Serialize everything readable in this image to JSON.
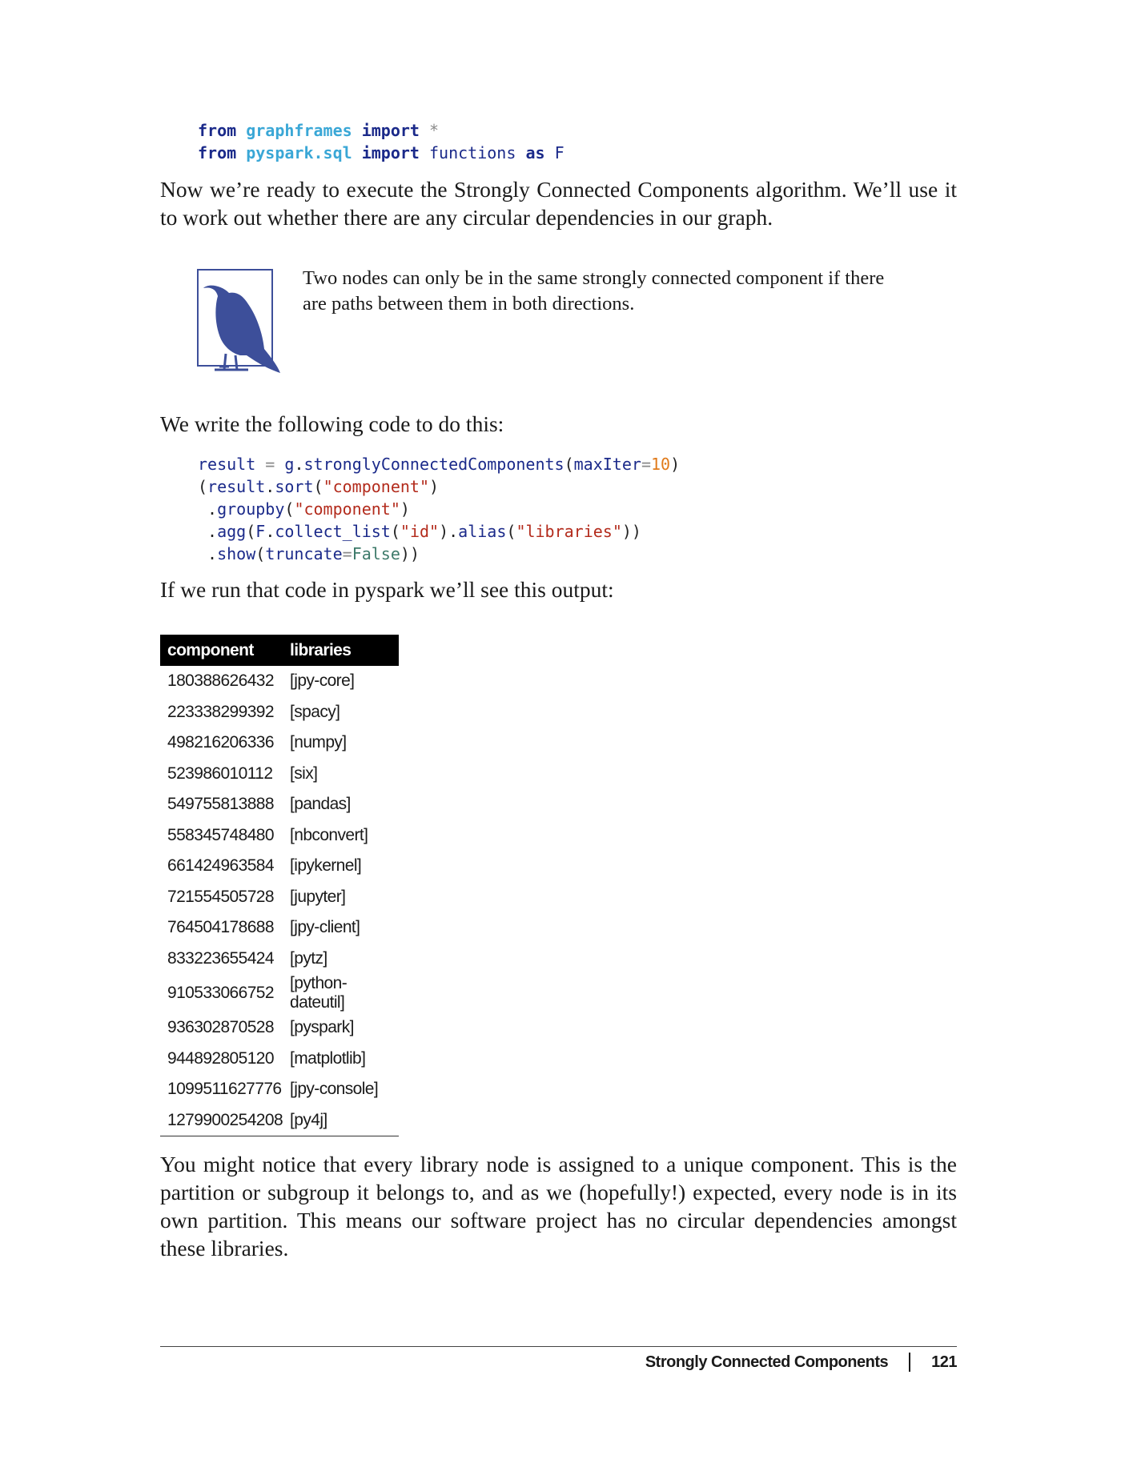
{
  "code_import": {
    "line1": {
      "kw1": "from",
      "mod": "graphframes",
      "kw2": "import",
      "rest": "*"
    },
    "line2": {
      "kw1": "from",
      "mod": "pyspark.sql",
      "kw2": "import",
      "name": "functions",
      "kw3": "as",
      "alias": "F"
    }
  },
  "para1": "Now we’re ready to execute the Strongly Connected Components algorithm. We’ll use it to work out whether there are any circular dependencies in our graph.",
  "note": {
    "icon": "bird-icon",
    "text": "Two nodes can only be in the same strongly connected component if there are paths between them in both directions."
  },
  "para2": "We write the following code to do this:",
  "code_scc": {
    "l1": {
      "var": "result",
      "eq": "=",
      "obj": "g",
      "method": "stronglyConnectedComponents",
      "param": "maxIter",
      "val": "10"
    },
    "l2": {
      "obj": "result",
      "method": "sort",
      "arg": "\"component\""
    },
    "l3": {
      "method": "groupby",
      "arg": "\"component\""
    },
    "l4": {
      "method": "agg",
      "obj": "F",
      "fn": "collect_list",
      "arg": "\"id\"",
      "fn2": "alias",
      "arg2": "\"libraries\""
    },
    "l5": {
      "method": "show",
      "param": "truncate",
      "val": "False"
    }
  },
  "para3": "If we run that code in pyspark we’ll see this output:",
  "table": {
    "headers": [
      "component",
      "libraries"
    ],
    "rows": [
      [
        "180388626432",
        "[jpy-core]"
      ],
      [
        "223338299392",
        "[spacy]"
      ],
      [
        "498216206336",
        "[numpy]"
      ],
      [
        "523986010112",
        "[six]"
      ],
      [
        "549755813888",
        "[pandas]"
      ],
      [
        "558345748480",
        "[nbconvert]"
      ],
      [
        "661424963584",
        "[ipykernel]"
      ],
      [
        "721554505728",
        "[jupyter]"
      ],
      [
        "764504178688",
        "[jpy-client]"
      ],
      [
        "833223655424",
        "[pytz]"
      ],
      [
        "910533066752",
        "[python-dateutil]"
      ],
      [
        "936302870528",
        "[pyspark]"
      ],
      [
        "944892805120",
        "[matplotlib]"
      ],
      [
        "1099511627776",
        "[jpy-console]"
      ],
      [
        "1279900254208",
        "[py4j]"
      ]
    ]
  },
  "para4": "You might notice that every library node is assigned to a unique component. This is the partition or subgroup it belongs to, and as we (hopefully!) expected, every node is in its own partition. This means our software project has no circular dependencies amongst these libraries.",
  "footer": {
    "section": "Strongly Connected Components",
    "page": "121"
  }
}
